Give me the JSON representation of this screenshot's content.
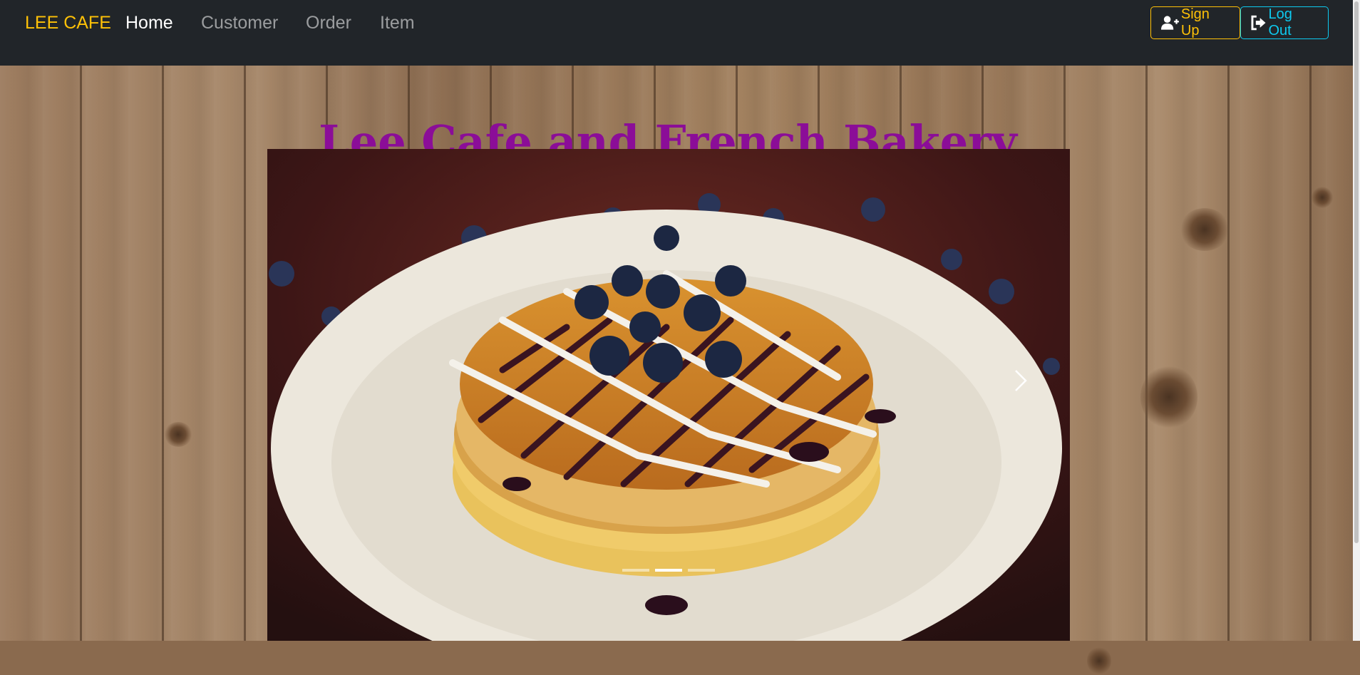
{
  "navbar": {
    "brand": "LEE CAFE",
    "links": [
      {
        "label": "Home",
        "active": true
      },
      {
        "label": "Customer",
        "active": false
      },
      {
        "label": "Order",
        "active": false
      },
      {
        "label": "Item",
        "active": false
      }
    ],
    "signup_label": "Sign Up",
    "logout_label": "Log Out"
  },
  "hero": {
    "title": "Lee Cafe and French Bakery"
  },
  "carousel": {
    "slide_count": 3,
    "active_index": 1
  },
  "colors": {
    "navbar_bg": "#212529",
    "brand": "#ffc107",
    "signup": "#ffc107",
    "logout": "#0dcaf0",
    "title": "#8b0d98"
  }
}
